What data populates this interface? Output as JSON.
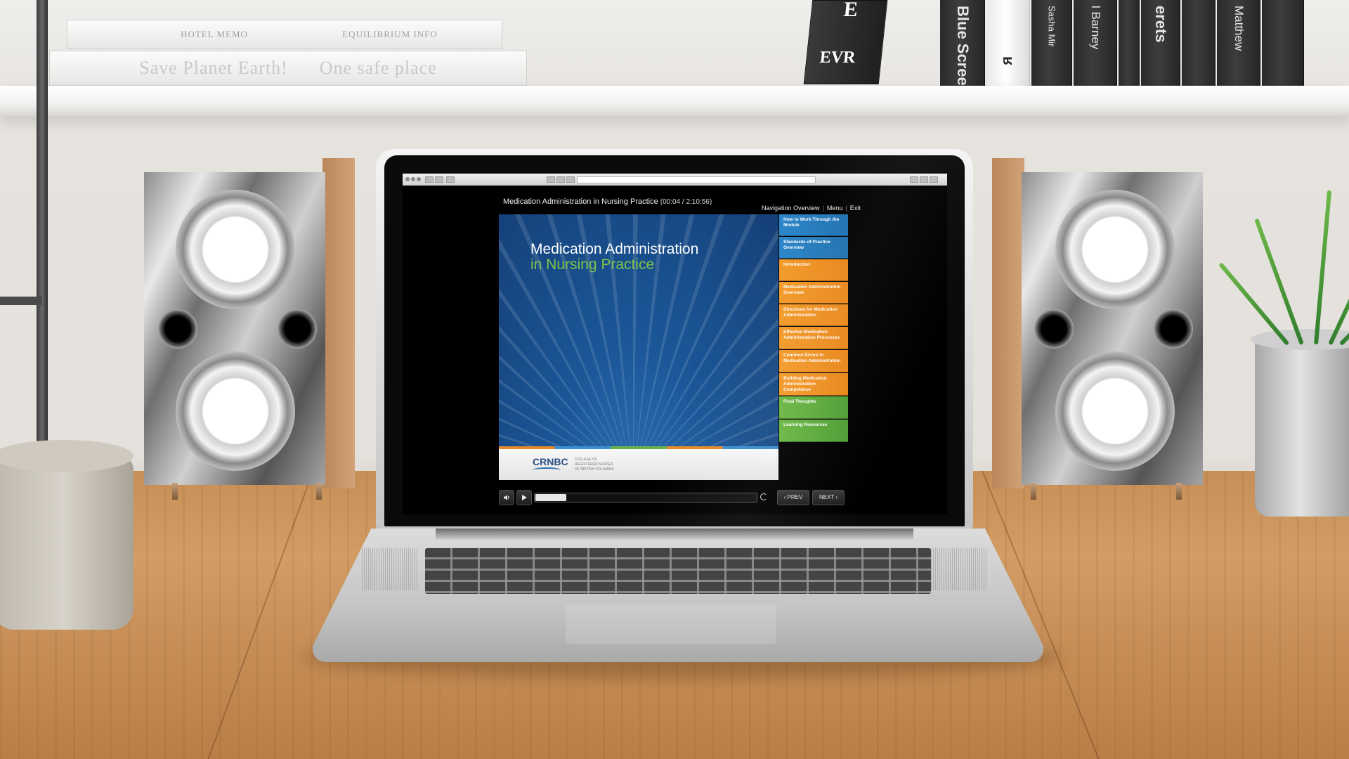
{
  "background": {
    "shelf_stacks": [
      {
        "spine": "HOTEL MEMO",
        "note": "EQUILIBRIUM INFO"
      },
      {
        "spine": "Save Planet Earth!",
        "note": "One safe place"
      }
    ],
    "books": [
      "Blue Screen",
      "ʁ",
      "Sasha Mir",
      "l Barney",
      "erets",
      "Matthew"
    ],
    "tilted_book": {
      "top": "E",
      "bottom": "EVR"
    }
  },
  "browser": {
    "url": ""
  },
  "course": {
    "title": "Medication Administration in Nursing Practice",
    "time": "(00:04 / 2:10:56)",
    "links": {
      "overview": "Navigation Overview",
      "menu": "Menu",
      "exit": "Exit"
    }
  },
  "slide": {
    "title_line1": "Medication Administration",
    "title_line2": "in Nursing Practice",
    "logo": "CRNBC",
    "logo_text": "COLLEGE OF\nREGISTERED NURSES\nOF BRITISH COLUMBIA"
  },
  "menu_items": [
    {
      "label": "How to Work Through the Module",
      "color": "#2c86c9"
    },
    {
      "label": "Standards of Practice Overview",
      "color": "#2c86c9"
    },
    {
      "label": "Introduction",
      "color": "#f49a2a"
    },
    {
      "label": "Medication Administration Overview",
      "color": "#f49a2a"
    },
    {
      "label": "Directives for Medication Administration",
      "color": "#f49a2a"
    },
    {
      "label": "Effective Medication Administration Processes",
      "color": "#f49a2a"
    },
    {
      "label": "Common Errors in Medication Administration",
      "color": "#f49a2a"
    },
    {
      "label": "Building Medication Administration Competence",
      "color": "#f49a2a"
    },
    {
      "label": "Final Thoughts",
      "color": "#6ab742"
    },
    {
      "label": "Learning Resources",
      "color": "#6ab742"
    }
  ],
  "controls": {
    "volume_icon": "speaker-icon",
    "play_icon": "play-icon",
    "replay_icon": "replay-icon",
    "prev_label": "PREV",
    "next_label": "NEXT",
    "progress": 0.14
  }
}
